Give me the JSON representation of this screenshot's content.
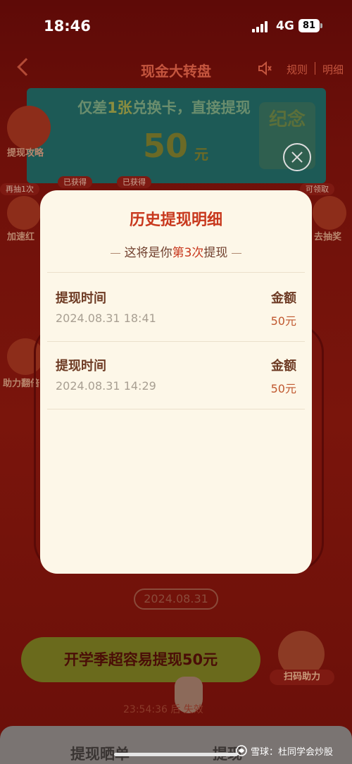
{
  "status": {
    "time": "18:46",
    "network": "4G",
    "battery": "81"
  },
  "nav": {
    "title": "现金大转盘",
    "rules": "规则",
    "detail": "明细"
  },
  "banner": {
    "line_pre": "仅差",
    "line_highlight": "1张",
    "line_post": "兑换卡，直接提现",
    "amount": "50",
    "unit": "元",
    "seal": "纪念"
  },
  "side": {
    "strategy": "提现攻略",
    "speed": "加速红",
    "assist_flip": "助力翻倍",
    "go_draw": "去抽奖",
    "tag_redraw": "再抽1次",
    "tag_got1": "已获得",
    "tag_got2": "已获得",
    "tag_claim": "可领取"
  },
  "modal": {
    "title": "历史提现明细",
    "subtitle_pre": "这将是你",
    "subtitle_highlight": "第3次",
    "subtitle_post": "提现",
    "records": [
      {
        "time_label": "提现时间",
        "time": "2024.08.31 18:41",
        "amount_label": "金额",
        "amount": "50元"
      },
      {
        "time_label": "提现时间",
        "time": "2024.08.31 14:29",
        "amount_label": "金额",
        "amount": "50元"
      }
    ]
  },
  "bottom": {
    "date": "2024.08.31",
    "cta": "开学季超容易提现50元",
    "scan": "扫码助力",
    "timer": "23:54:36 后   失效",
    "tab_left": "提现晒单",
    "tab_right": "提现",
    "watermark": "雪球：杜同学会炒股"
  },
  "colors": {
    "accent": "#c8381d",
    "modal_bg": "#fdf7e8",
    "overlay": "#6a0c09"
  }
}
